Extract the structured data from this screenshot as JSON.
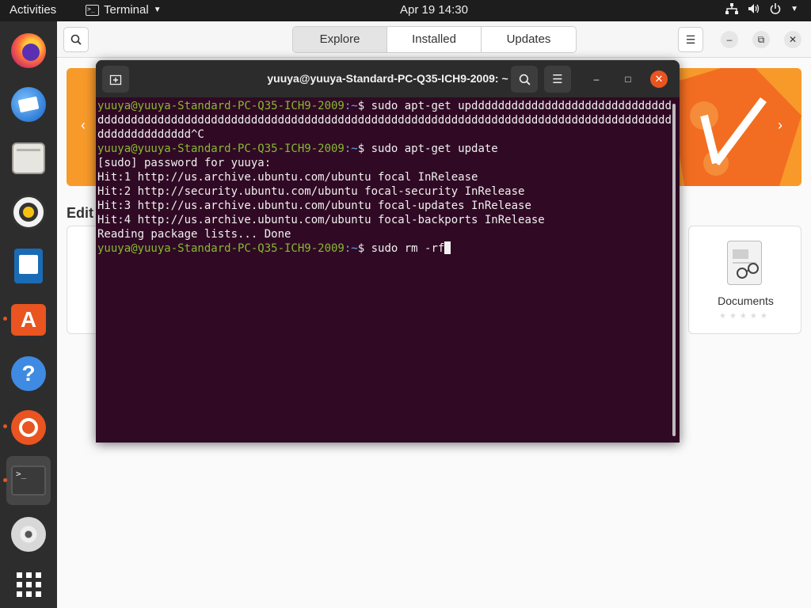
{
  "topbar": {
    "activities": "Activities",
    "app_name": "Terminal",
    "term_glyph": ">_",
    "clock": "Apr 19  14:30"
  },
  "dock": {
    "items": [
      {
        "name": "Firefox",
        "icon": "firefox-icon"
      },
      {
        "name": "Thunderbird",
        "icon": "thunderbird-icon"
      },
      {
        "name": "Files",
        "icon": "files-icon"
      },
      {
        "name": "Rhythmbox",
        "icon": "rhythmbox-icon"
      },
      {
        "name": "LibreOffice Writer",
        "icon": "writer-icon"
      },
      {
        "name": "Ubuntu Software",
        "icon": "software-icon"
      },
      {
        "name": "Help",
        "icon": "help-icon"
      },
      {
        "name": "Ubuntu",
        "icon": "ubuntu-icon"
      },
      {
        "name": "Terminal",
        "icon": "terminal-icon"
      },
      {
        "name": "Disc",
        "icon": "disc-icon"
      },
      {
        "name": "Show Applications",
        "icon": "app-grid-icon"
      }
    ]
  },
  "software": {
    "tabs": [
      "Explore",
      "Installed",
      "Updates"
    ],
    "selected_tab": "Explore",
    "section_title": "Edit",
    "card_label": "Documents"
  },
  "terminal": {
    "title": "yuuya@yuuya-Standard-PC-Q35-ICH9-2009: ~",
    "prompt_user": "yuuya@yuuya-Standard-PC-Q35-ICH9-2009",
    "prompt_path": ":~",
    "prompt_dollar": "$ ",
    "lines": [
      {
        "type": "prompt",
        "cmd": "sudo apt-get updddddddddddddddddddddddddddddddddddddddddddddddddddddddddddddddddddddddddddddddddddddddddddddddddddddddddddddddddddddddddddddddddd^C"
      },
      {
        "type": "prompt",
        "cmd": "sudo apt-get update"
      },
      {
        "type": "out",
        "text": "[sudo] password for yuuya:"
      },
      {
        "type": "out",
        "text": "Hit:1 http://us.archive.ubuntu.com/ubuntu focal InRelease"
      },
      {
        "type": "out",
        "text": "Hit:2 http://security.ubuntu.com/ubuntu focal-security InRelease"
      },
      {
        "type": "out",
        "text": "Hit:3 http://us.archive.ubuntu.com/ubuntu focal-updates InRelease"
      },
      {
        "type": "out",
        "text": "Hit:4 http://us.archive.ubuntu.com/ubuntu focal-backports InRelease"
      },
      {
        "type": "out",
        "text": "Reading package lists... Done"
      },
      {
        "type": "prompt",
        "cmd": "sudo rm -rf",
        "cursor": true
      }
    ]
  },
  "colors": {
    "terminal_bg": "#300a24",
    "prompt_user": "#87b830",
    "prompt_path": "#6fa4e6",
    "accent": "#e95420"
  }
}
